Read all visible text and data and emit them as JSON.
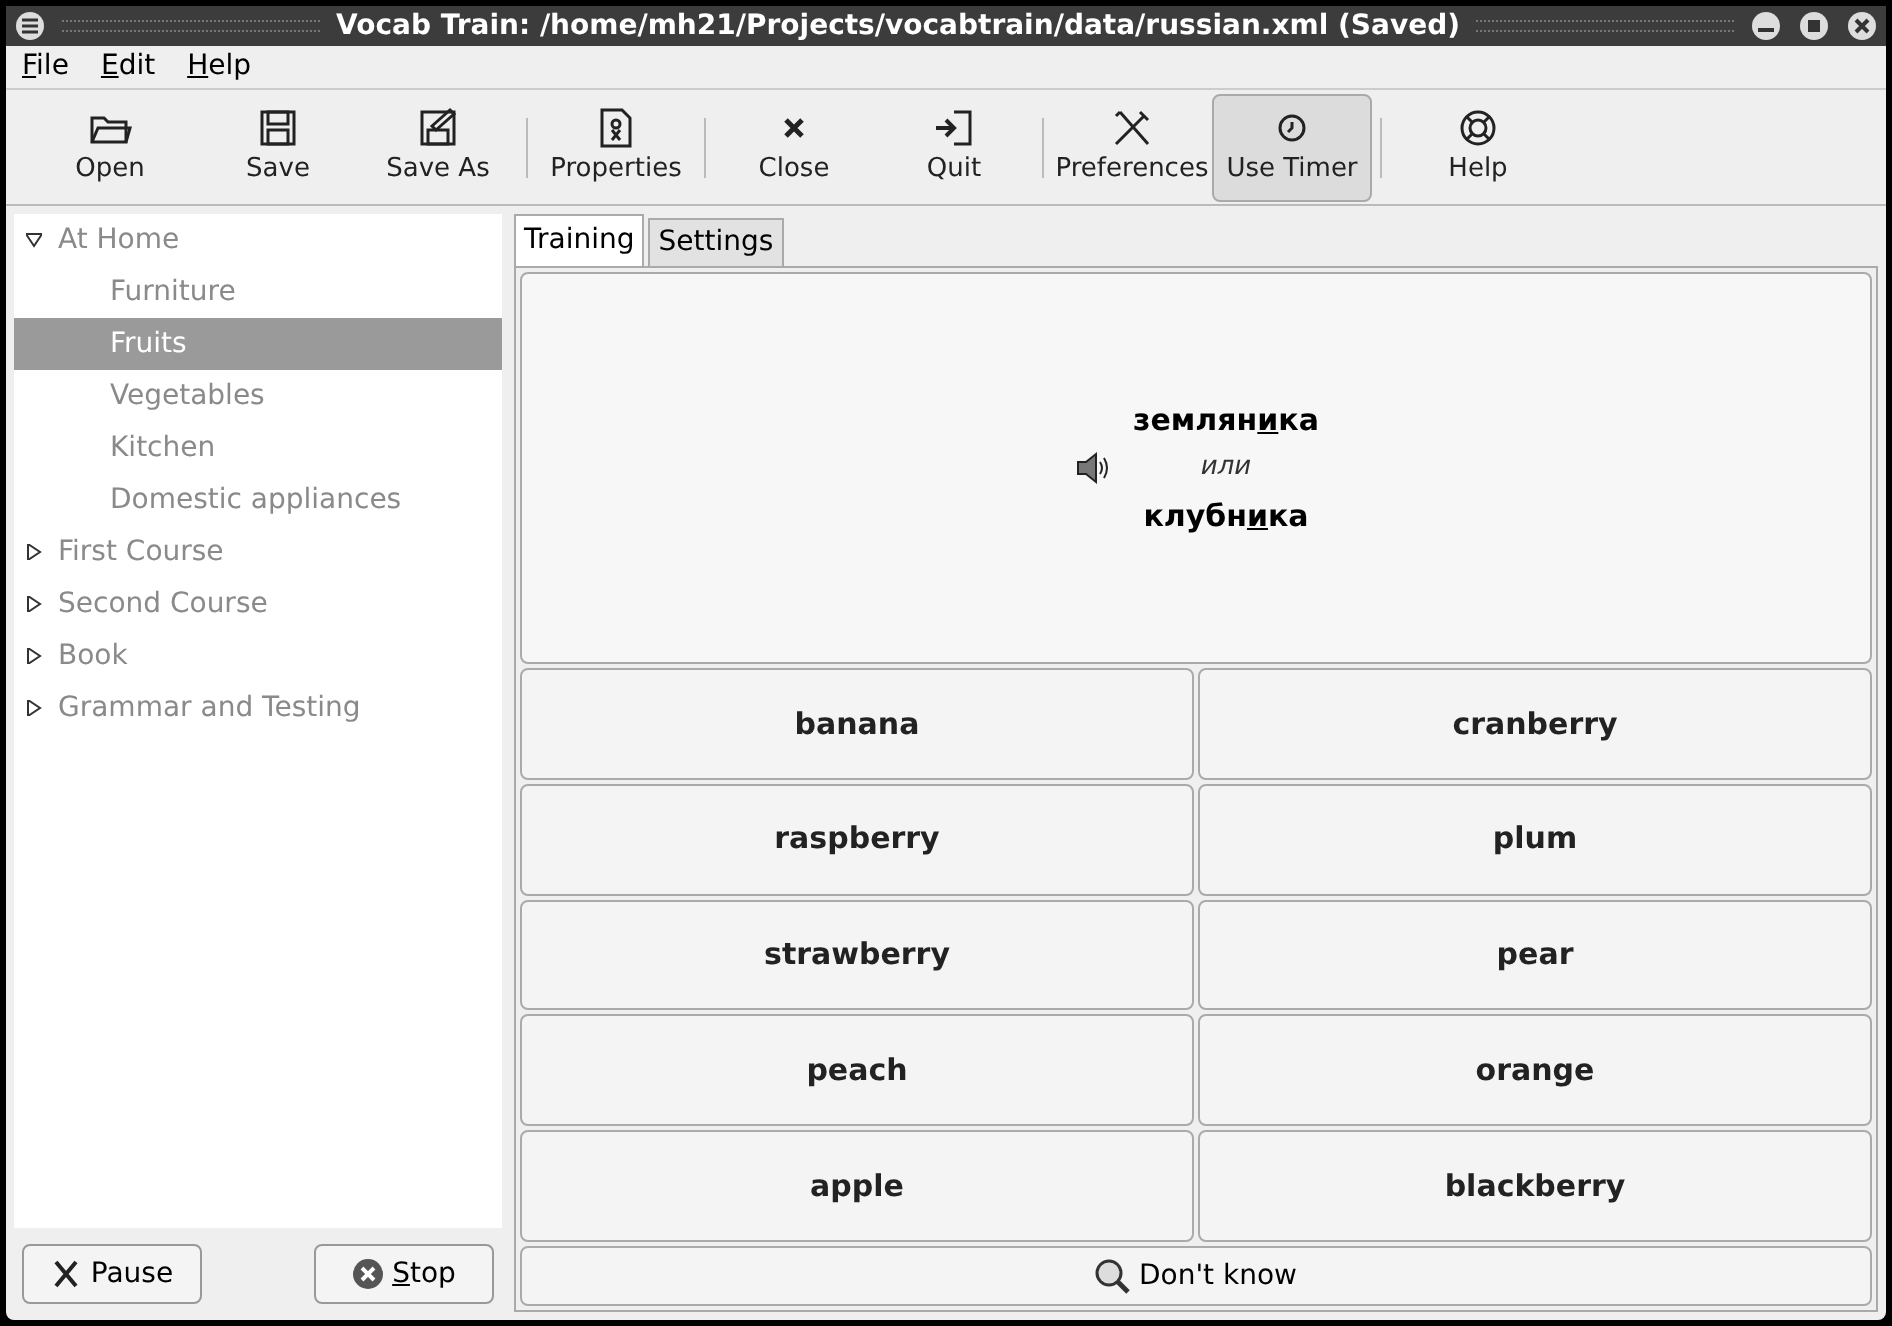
{
  "window": {
    "title": "Vocab Train: /home/mh21/Projects/vocabtrain/data/russian.xml (Saved)"
  },
  "menu": [
    {
      "label": "File",
      "mnemonic": true
    },
    {
      "label": "Edit",
      "mnemonic": true
    },
    {
      "label": "Help",
      "mnemonic": true
    }
  ],
  "toolbar": [
    {
      "label": "Open",
      "kind": "folder",
      "separator_after": false,
      "pressed": false
    },
    {
      "label": "Save",
      "kind": "floppy",
      "separator_after": false,
      "pressed": false
    },
    {
      "label": "Save As",
      "kind": "floppy-edit",
      "separator_after": true,
      "pressed": false
    },
    {
      "label": "Properties",
      "kind": "document",
      "separator_after": true,
      "pressed": false
    },
    {
      "label": "Close",
      "kind": "cross",
      "separator_after": false,
      "pressed": false
    },
    {
      "label": "Quit",
      "kind": "exit",
      "separator_after": true,
      "pressed": false
    },
    {
      "label": "Preferences",
      "kind": "tools",
      "separator_after": false,
      "pressed": false
    },
    {
      "label": "Use Timer",
      "kind": "clock",
      "separator_after": true,
      "pressed": true
    },
    {
      "label": "Help",
      "kind": "lifebuoy",
      "separator_after": false,
      "pressed": false
    }
  ],
  "tree": [
    {
      "label": "At Home",
      "expanded": true,
      "selected": false,
      "children": [
        {
          "label": "Furniture",
          "selected": false
        },
        {
          "label": "Fruits",
          "selected": true
        },
        {
          "label": "Vegetables",
          "selected": false
        },
        {
          "label": "Kitchen",
          "selected": false
        },
        {
          "label": "Domestic appliances",
          "selected": false
        }
      ]
    },
    {
      "label": "First Course",
      "expanded": false,
      "selected": false
    },
    {
      "label": "Second Course",
      "expanded": false,
      "selected": false
    },
    {
      "label": "Book",
      "expanded": false,
      "selected": false
    },
    {
      "label": "Grammar and Testing",
      "expanded": false,
      "selected": false
    }
  ],
  "side_buttons": [
    {
      "label": "Pause",
      "kind": "pause",
      "mnemonic": false
    },
    {
      "label": "Stop",
      "kind": "stop",
      "mnemonic": true
    }
  ],
  "tabs": [
    {
      "label": "Training",
      "selected": true
    },
    {
      "label": "Settings",
      "selected": false
    }
  ],
  "question": {
    "words": [
      {
        "before": "землян",
        "stress": "и",
        "after": "ка"
      },
      {
        "before": "клубн",
        "stress": "и",
        "after": "ка"
      }
    ],
    "separator": "или"
  },
  "answers": [
    "banana",
    "cranberry",
    "raspberry",
    "plum",
    "strawberry",
    "pear",
    "peach",
    "orange",
    "apple",
    "blackberry"
  ],
  "dont_know": "Don't know"
}
